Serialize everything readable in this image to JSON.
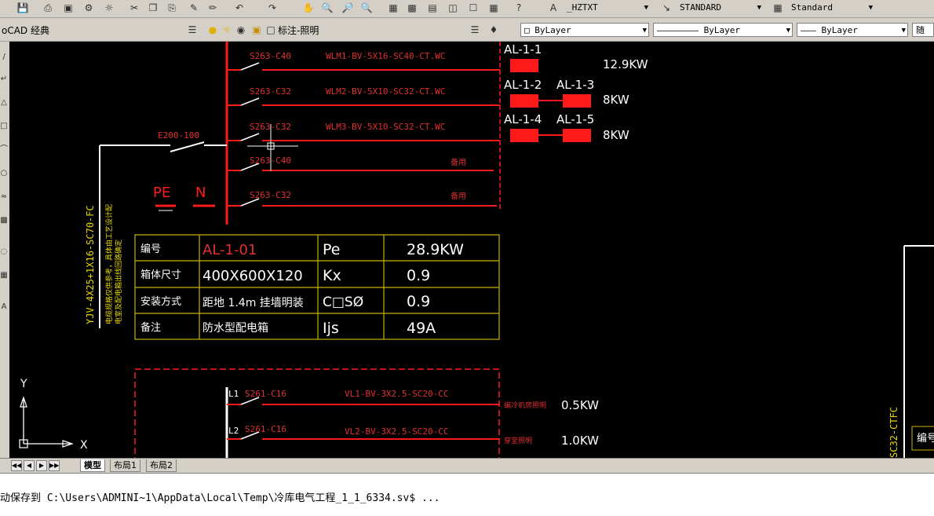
{
  "toolbar": {
    "text_style": "_HZTXT",
    "dim_style": "STANDARD",
    "table_style": "Standard",
    "workspace": "oCAD 经典",
    "layer": "标注-照明",
    "color": "ByLayer",
    "linetype": "ByLayer",
    "lineweight": "ByLayer",
    "plot_style": "随"
  },
  "drawing": {
    "breakers": [
      "S263-C40",
      "S263-C32",
      "S263-C32",
      "S263-C40",
      "S263-C32"
    ],
    "circuits": [
      "WLM1-BV-5X16-SC40-CT.WC",
      "WLM2-BV-5X10-SC32-CT.WC",
      "WLM3-BV-5X10-SC32-CT.WC"
    ],
    "spare_label": "备用",
    "main_breaker": "E200-100",
    "pe_label": "PE",
    "n_label": "N",
    "feeder_cable": "YJV-4X25+1X16-SC70-FC",
    "feeder_note_1": "电缆规格仅供参考，具体由工艺设计配",
    "feeder_note_2": "电室及配电箱出线回路确定",
    "loads": [
      {
        "names": [
          "AL-1-1"
        ],
        "power": "12.9KW"
      },
      {
        "names": [
          "AL-1-2",
          "AL-1-3"
        ],
        "power": "8KW"
      },
      {
        "names": [
          "AL-1-4",
          "AL-1-5"
        ],
        "power": "8KW"
      }
    ],
    "table": {
      "rows": [
        [
          "编号",
          "AL-1-01",
          "Pe",
          "28.9KW"
        ],
        [
          "箱体尺寸",
          "400X600X120",
          "Kx",
          "0.9"
        ],
        [
          "安装方式",
          "距地 1.4m 挂墙明装",
          "C□SØ",
          "0.9"
        ],
        [
          "备注",
          "防水型配电箱",
          "Ijs",
          "49A"
        ]
      ]
    },
    "lower": {
      "circuits": [
        {
          "phase": "L1",
          "breaker": "S261-C16",
          "cable": "VL1-BV-3X2.5-SC20-CC",
          "desc": "编冷机房照明",
          "power": "0.5KW"
        },
        {
          "phase": "L2",
          "breaker": "S261-C16",
          "cable": "VL2-BV-3X2.5-SC20-CC",
          "desc": "穿堂照明",
          "power": "1.0KW"
        }
      ]
    },
    "right_cable": "SC32-CTFC",
    "right_table_head": "编号",
    "ucs": {
      "y": "Y",
      "x": "X"
    }
  },
  "tabs": [
    "模型",
    "布局1",
    "布局2"
  ],
  "active_tab": "模型",
  "command": {
    "text": "动保存到 C:\\Users\\ADMINI~1\\AppData\\Local\\Temp\\冷库电气工程_1_1_6334.sv$ ..."
  },
  "colors": {
    "line": "#ff1a1a",
    "text_red": "#e03030",
    "table_border": "#c8b400",
    "canvas": "#000000",
    "white": "#ffffff"
  },
  "icons": [
    "save-icon",
    "print-icon",
    "plot-preview-icon",
    "publish-icon",
    "cut-icon",
    "copy-icon",
    "paste-icon",
    "match-properties-icon",
    "undo-icon",
    "redo-icon",
    "pan-icon",
    "zoom-realtime-icon",
    "zoom-window-icon",
    "zoom-previous-icon",
    "properties-icon",
    "design-center-icon",
    "tool-palettes-icon",
    "markup-icon",
    "calculator-icon",
    "help-icon",
    "text-style-icon",
    "dim-style-icon",
    "table-style-icon",
    "layer-manager-icon",
    "bulb-icon",
    "sun-icon",
    "lock-icon",
    "layer-previous-icon",
    "layer-state-icon"
  ]
}
